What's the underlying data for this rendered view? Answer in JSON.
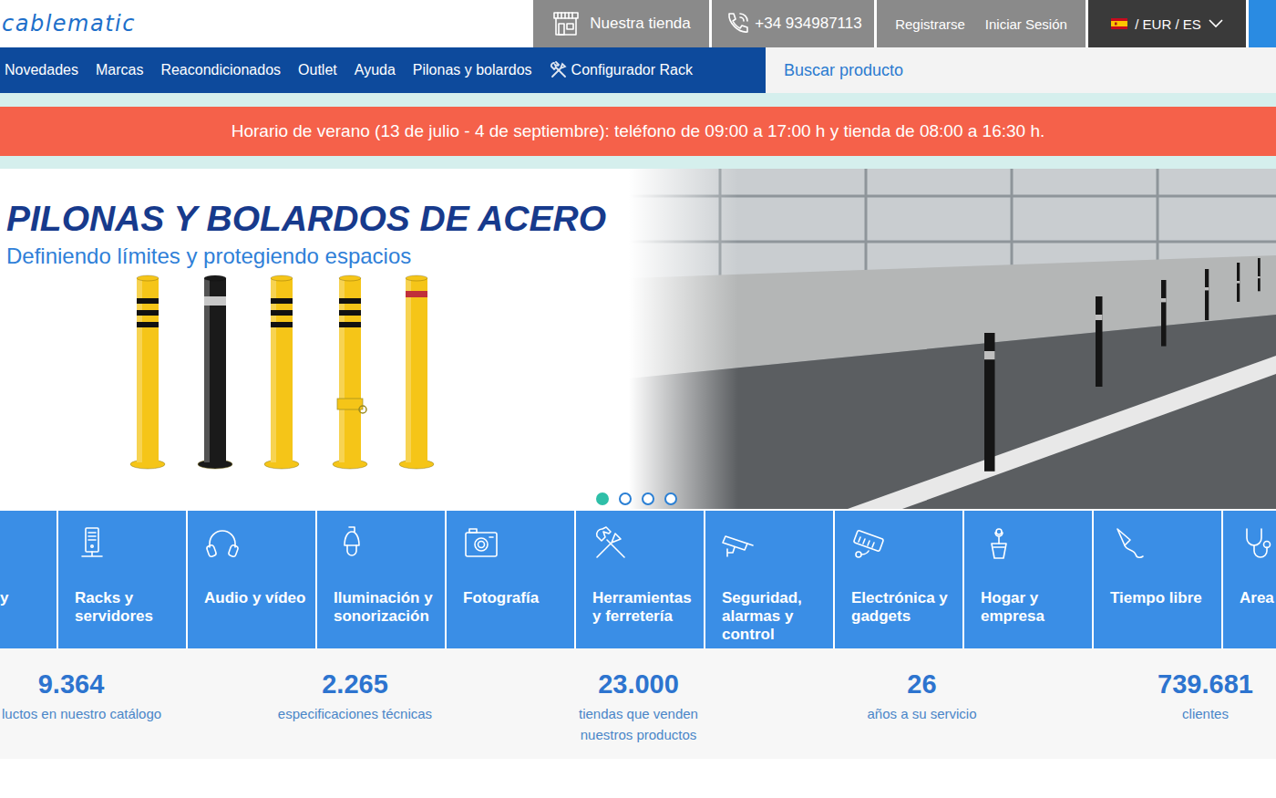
{
  "header": {
    "logo": "cablematic",
    "store": "Nuestra tienda",
    "phone": "+34 934987113",
    "register": "Registrarse",
    "login": "Iniciar Sesión",
    "locale": "/ EUR / ES"
  },
  "nav": {
    "items": [
      "Novedades",
      "Marcas",
      "Reacondicionados",
      "Outlet",
      "Ayuda",
      "Pilonas y bolardos"
    ],
    "config": "Configurador Rack"
  },
  "search": {
    "placeholder": "Buscar producto"
  },
  "notice": "Horario de verano (13 de julio - 4 de septiembre): teléfono de 09:00 a 17:00 h y tienda de 08:00 a 16:30 h.",
  "hero": {
    "title": "PILONAS Y BOLARDOS DE ACERO",
    "subtitle": "Definiendo límites y protegiendo espacios",
    "dots": [
      {
        "selected": true
      },
      {
        "selected": false
      },
      {
        "selected": false
      },
      {
        "selected": false
      }
    ]
  },
  "categories": [
    {
      "label": "y"
    },
    {
      "label": "Racks y servidores"
    },
    {
      "label": "Audio y vídeo"
    },
    {
      "label": "Iluminación y sonorización"
    },
    {
      "label": "Fotografía"
    },
    {
      "label": "Herramientas y ferretería"
    },
    {
      "label": "Seguridad, alarmas y control"
    },
    {
      "label": "Electrónica y gadgets"
    },
    {
      "label": "Hogar y empresa"
    },
    {
      "label": "Tiempo libre"
    },
    {
      "label": "Area"
    }
  ],
  "stats": [
    {
      "value": "9.364",
      "label": "luctos en nuestro catálogo"
    },
    {
      "value": "2.265",
      "label": "especificaciones técnicas"
    },
    {
      "value": "23.000",
      "label": "tiendas que venden nuestros productos"
    },
    {
      "value": "26",
      "label": "años a su servicio"
    },
    {
      "value": "739.681",
      "label": "clientes"
    }
  ]
}
